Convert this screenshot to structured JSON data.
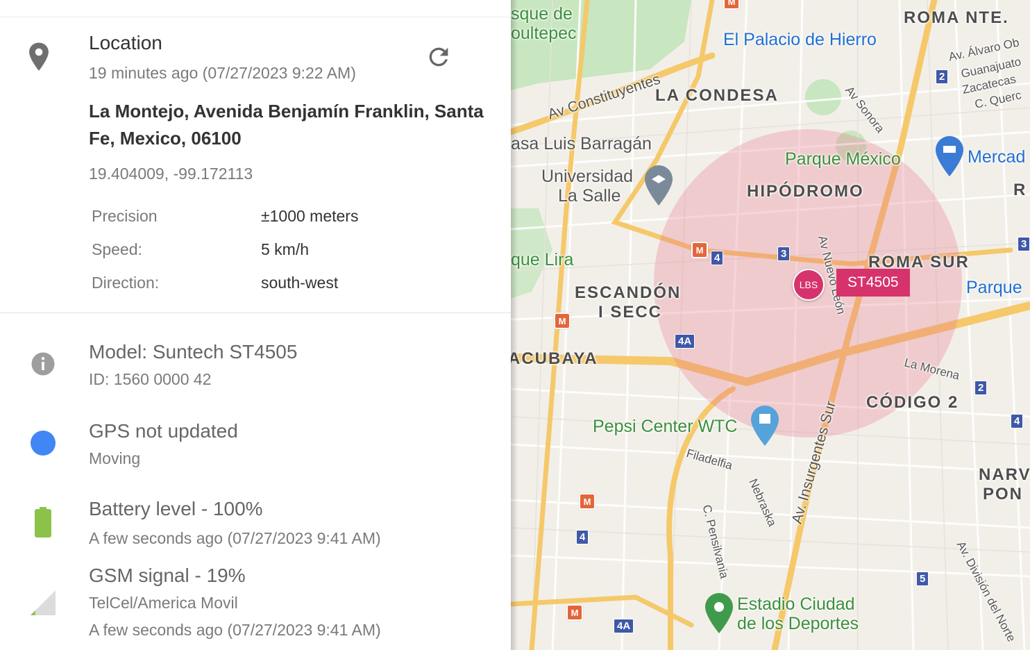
{
  "location": {
    "title": "Location",
    "time": "19 minutes ago (07/27/2023 9:22 AM)",
    "address": "La Montejo, Avenida Benjamín Franklin, Santa Fe, Mexico, 06100",
    "coords": "19.404009, -99.172113",
    "details": [
      {
        "label": "Precision",
        "value": "±1000 meters"
      },
      {
        "label": "Speed:",
        "value": "5 km/h"
      },
      {
        "label": "Direction:",
        "value": "south-west"
      }
    ]
  },
  "device": {
    "model": "Model: Suntech ST4505",
    "id": "ID: 1560 0000 42"
  },
  "gps": {
    "title": "GPS not updated",
    "state": "Moving",
    "dot_color": "#4285f4"
  },
  "battery": {
    "title": "Battery level - 100%",
    "time": "A few seconds ago (07/27/2023 9:41 AM)",
    "level": 1.0,
    "color": "#8bc34a"
  },
  "gsm": {
    "title": "GSM signal - 19%",
    "operator": "TelCel/America Movil",
    "time": "A few seconds ago (07/27/2023 9:41 AM)",
    "level": 0.19
  },
  "map": {
    "marker_label": "LBS",
    "device_label": "ST4505",
    "accent": "#d6336c",
    "districts": [
      "ROMA NTE.",
      "LA CONDESA",
      "HIPÓDROMO",
      "ROMA SUR",
      "ESCANDÓN",
      "I SECC",
      "ACUBAYA",
      "CÓDIGO 2",
      "NARV",
      "PON",
      "R"
    ],
    "pois": [
      "sque de",
      "oultepec",
      "El Palacio de Hierro",
      "asa Luis Barragán",
      "Universidad",
      "La Salle",
      "Parque México",
      "Mercad",
      "que Lira",
      "Parque",
      "Pepsi Center WTC",
      "Estadio Ciudad",
      "de los Deportes"
    ],
    "roads": [
      "Av Constituyentes",
      "Av. Álvaro Ob",
      "Guanajuato",
      "Zacatecas",
      "C. Querc",
      "Av Sonora",
      "Av Nuevo León",
      "La Morena",
      "Filadelfia",
      "Nebraska",
      "C. Pensilvania",
      "Av. Insurgentes Sur",
      "Av. División del Norte"
    ],
    "route_badges": [
      "2",
      "4",
      "3",
      "4A",
      "2",
      "4",
      "4",
      "5",
      "4A",
      "3"
    ]
  }
}
